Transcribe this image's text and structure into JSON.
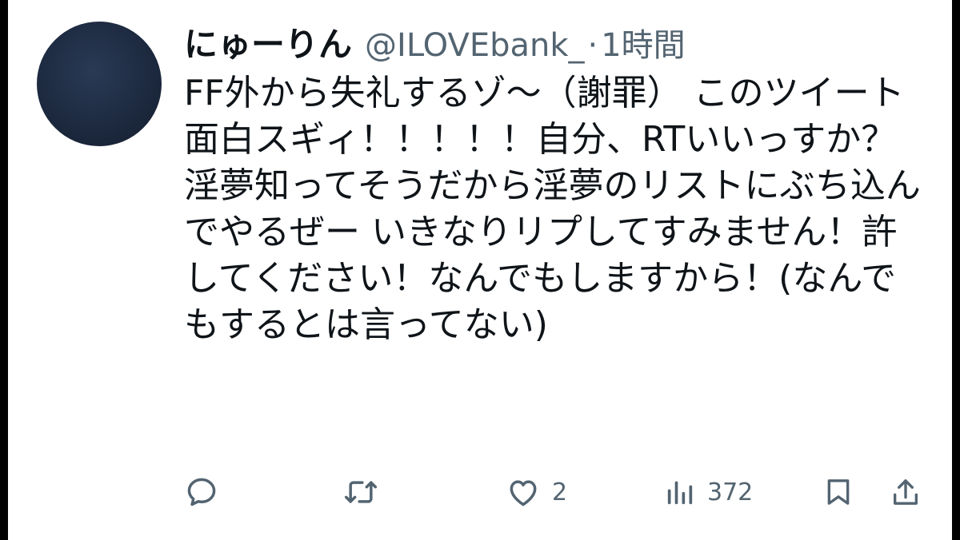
{
  "tweet": {
    "display_name": "にゅーりん",
    "handle": "@ILOVEbank_",
    "separator": "·",
    "time": "1時間",
    "text": "FF外から失礼するゾ～（謝罪） このツイート面白スギィ！！！！！自分、RTいいっすか？ 淫夢知ってそうだから淫夢のリストにぶち込んでやるぜー いきなりリプしてすみません！許してください！なんでもしますから！(なんでもするとは言ってない)"
  },
  "actions": {
    "reply": {
      "icon": "reply-icon",
      "count": ""
    },
    "retweet": {
      "icon": "retweet-icon",
      "count": ""
    },
    "like": {
      "icon": "heart-icon",
      "count": "2"
    },
    "views": {
      "icon": "views-icon",
      "count": "372"
    },
    "bookmark": {
      "icon": "bookmark-icon"
    },
    "share": {
      "icon": "share-icon"
    }
  },
  "colors": {
    "text": "#0f1419",
    "secondary": "#536471",
    "background": "#ffffff",
    "letterbox": "#000000"
  }
}
